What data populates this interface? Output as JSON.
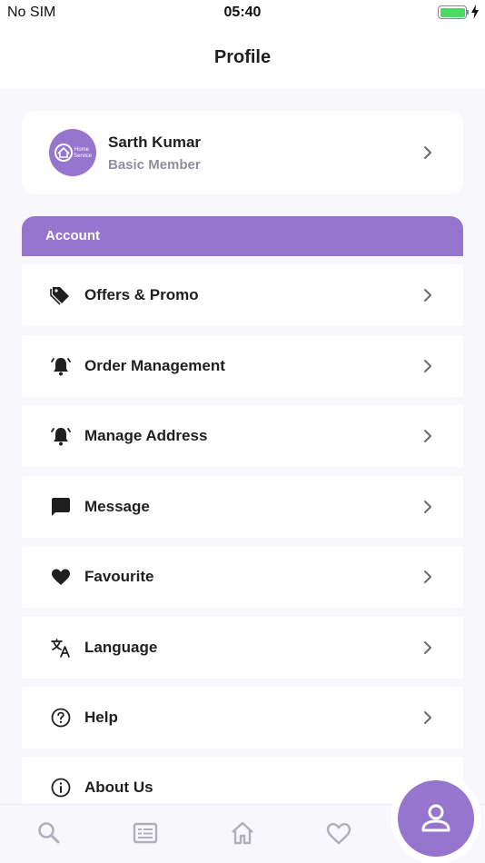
{
  "status_bar": {
    "carrier": "No SIM",
    "time": "05:40",
    "battery_level": 1.0
  },
  "header": {
    "title": "Profile"
  },
  "profile": {
    "name": "Sarth Kumar",
    "membership": "Basic Member",
    "logo_text_line1": "Home",
    "logo_text_line2": "Service"
  },
  "account_section": {
    "title": "Account",
    "items": [
      {
        "label": "Offers & Promo",
        "icon": "tag-icon"
      },
      {
        "label": "Order Management",
        "icon": "bell-ring-icon"
      },
      {
        "label": "Manage Address",
        "icon": "bell-ring-icon"
      },
      {
        "label": "Message",
        "icon": "message-icon"
      },
      {
        "label": "Favourite",
        "icon": "heart-icon"
      },
      {
        "label": "Language",
        "icon": "translate-icon"
      },
      {
        "label": "Help",
        "icon": "help-circle-icon"
      },
      {
        "label": "About Us",
        "icon": "info-icon"
      }
    ]
  },
  "tab_bar": {
    "tabs": [
      {
        "icon": "search-icon"
      },
      {
        "icon": "list-card-icon"
      },
      {
        "icon": "home-icon"
      },
      {
        "icon": "heart-outline-icon"
      },
      {
        "icon": "profile-icon",
        "active": true
      }
    ]
  },
  "colors": {
    "accent": "#9575cd",
    "background": "#f8f7fc",
    "text": "#1f1f1f",
    "muted": "#8f8f9f"
  }
}
